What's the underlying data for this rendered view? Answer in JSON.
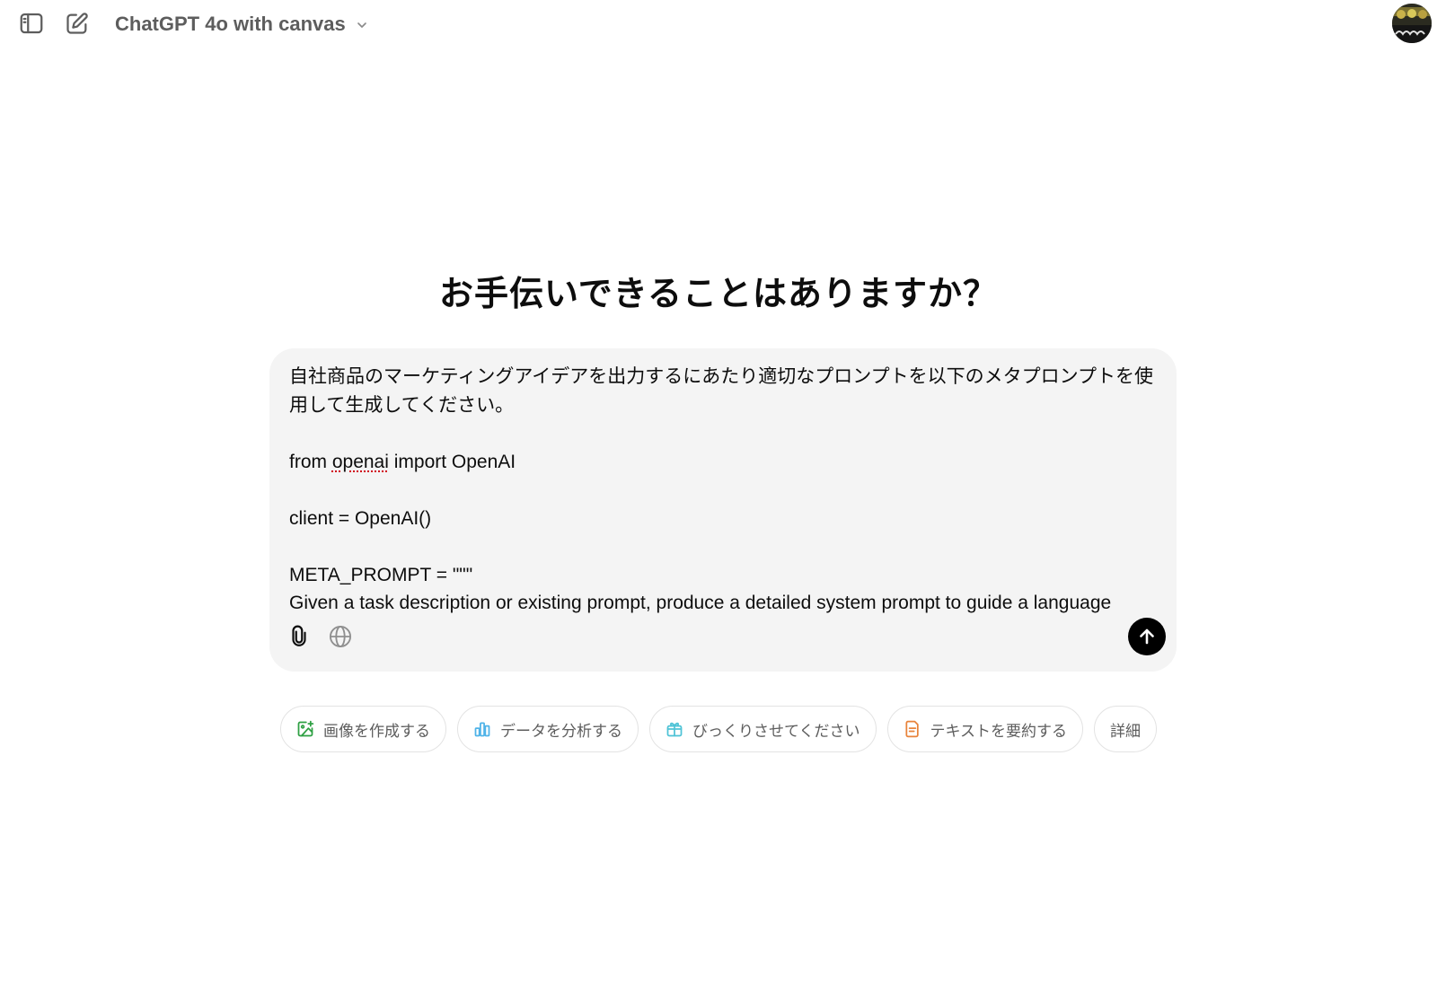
{
  "header": {
    "model_name": "ChatGPT 4o with canvas",
    "icons": {
      "sidebar_toggle": "sidebar-toggle-icon",
      "new_chat": "new-chat-icon",
      "model_dropdown": "chevron-down-icon",
      "avatar": "user-avatar"
    }
  },
  "main": {
    "headline": "お手伝いできることはありますか？"
  },
  "composer": {
    "line_1": "自社商品のマーケティングアイデアを出力するにあたり適切なプロンプトを以下のメタプロンプトを使",
    "line_2": "用して生成してください。",
    "line_3": "",
    "line_4_prefix": "from ",
    "line_4_underlined": "openai",
    "line_4_suffix": " import OpenAI",
    "line_5": "",
    "line_6": "client = OpenAI()",
    "line_7": "",
    "line_8": "META_PROMPT = \"\"\"",
    "line_9": "Given a task description or existing prompt, produce a detailed system prompt to guide a language",
    "attach_icon": "paperclip-icon",
    "search_icon": "globe-icon",
    "send_icon": "arrow-up-icon"
  },
  "suggestions": [
    {
      "label": "画像を作成する",
      "icon": "image-create-icon",
      "color": "#2ea043"
    },
    {
      "label": "データを分析する",
      "icon": "bar-chart-icon",
      "color": "#4fb3e8"
    },
    {
      "label": "びっくりさせてください",
      "icon": "gift-icon",
      "color": "#4fc3d6"
    },
    {
      "label": "テキストを要約する",
      "icon": "document-icon",
      "color": "#e8833a"
    },
    {
      "label": "詳細",
      "icon": "",
      "color": ""
    }
  ],
  "colors": {
    "composer_bg": "#f4f4f4",
    "send_button": "#000000",
    "chip_border": "#e3e3e3",
    "muted_text": "#5d5d5d"
  }
}
